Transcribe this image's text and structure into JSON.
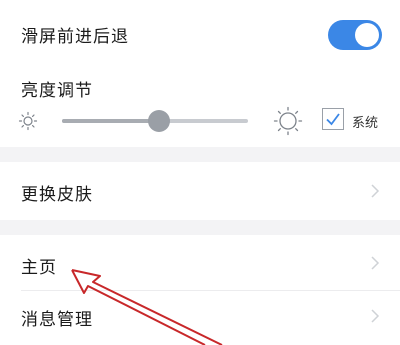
{
  "settings": {
    "swipe_nav": {
      "label": "滑屏前进后退",
      "enabled": true
    },
    "brightness": {
      "label": "亮度调节",
      "level": 0.52,
      "follow_system": true,
      "system_label": "系统"
    },
    "skin": {
      "label": "更换皮肤"
    },
    "home": {
      "label": "主页"
    },
    "messages": {
      "label": "消息管理"
    }
  },
  "colors": {
    "accent": "#3b87e6",
    "annotation_arrow": "#c8282a",
    "background": "#f3f3f5"
  },
  "icons": [
    "sun-small-icon",
    "sun-large-icon",
    "check-icon",
    "chevron-right-icon"
  ]
}
